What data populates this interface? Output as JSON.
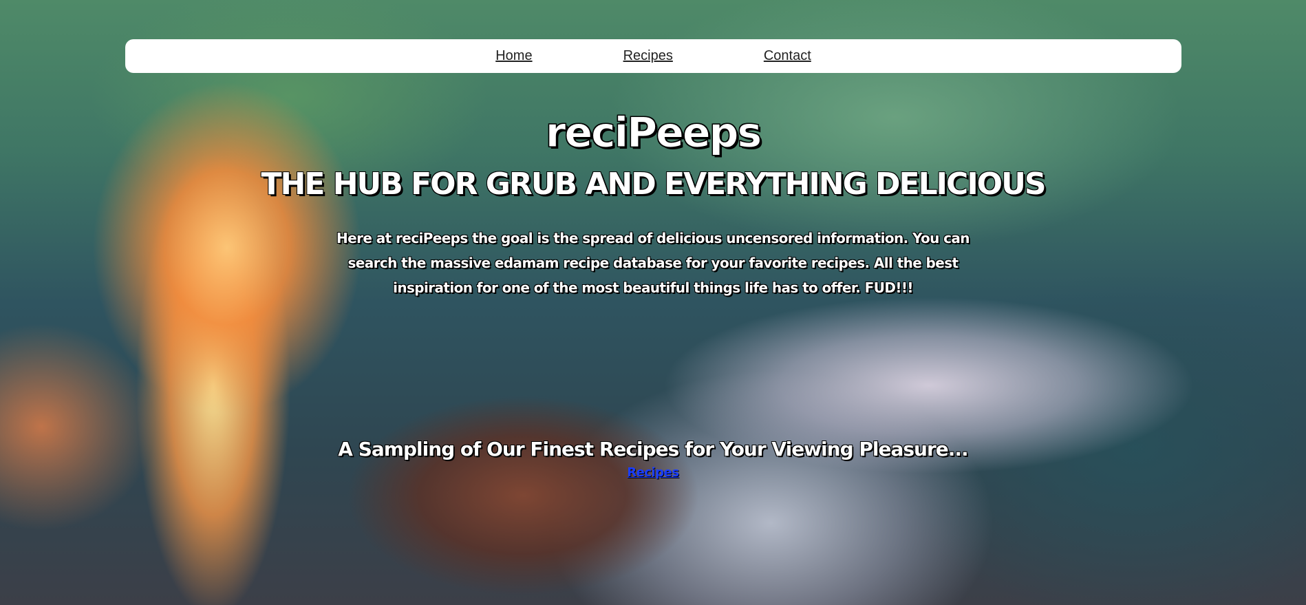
{
  "nav": {
    "items": [
      {
        "label": "Home"
      },
      {
        "label": "Recipes"
      },
      {
        "label": "Contact"
      }
    ]
  },
  "hero": {
    "title": "reciPeeps",
    "tagline": "THE HUB FOR GRUB AND EVERYTHING DELICIOUS",
    "intro": "Here at reciPeeps the goal is the spread of delicious uncensored information. You can search the massive edamam recipe database for your favorite recipes. All the best inspiration for one of the most beautiful things life has to offer. FUD!!!"
  },
  "sampling": {
    "heading": "A Sampling of Our Finest Recipes for Your Viewing Pleasure...",
    "link_label": "Recipes"
  }
}
